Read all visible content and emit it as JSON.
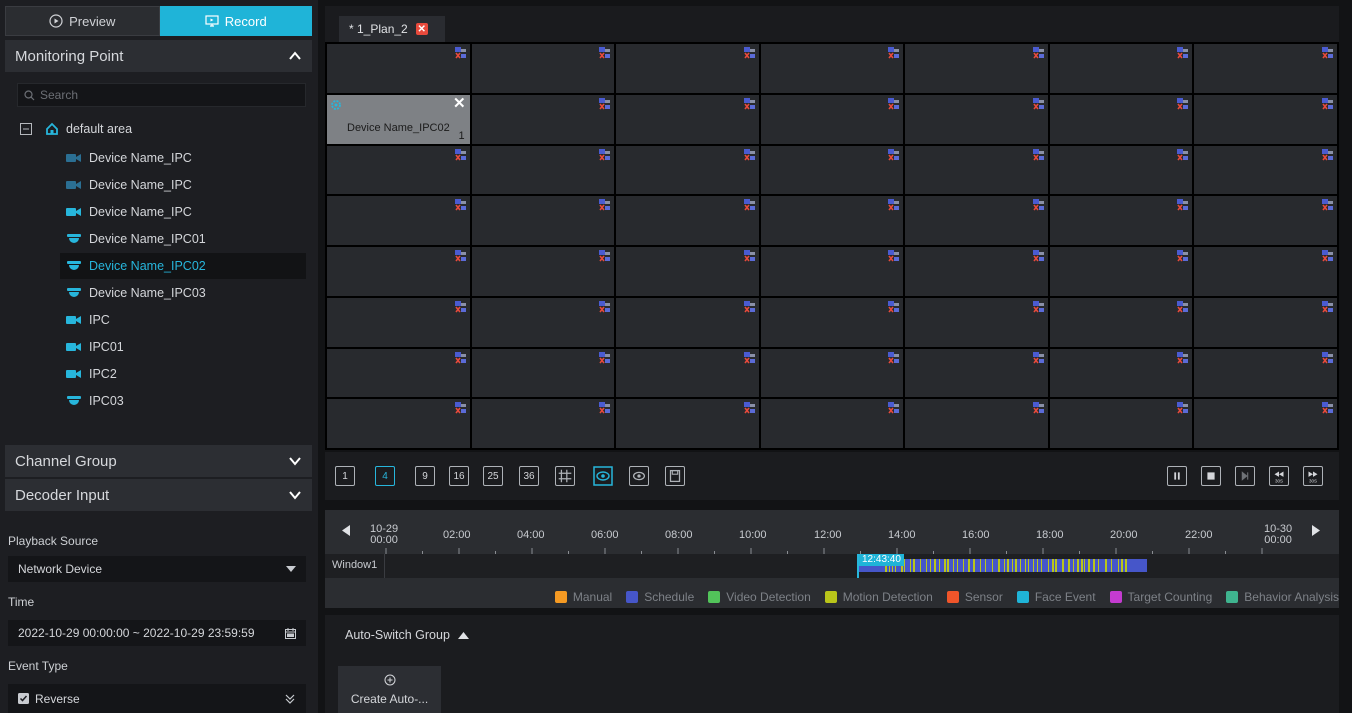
{
  "tabs": {
    "preview": "Preview",
    "record": "Record"
  },
  "monitoring": {
    "title": "Monitoring Point",
    "search_placeholder": "Search",
    "area": "default area",
    "devices": [
      {
        "name": "Device Name_IPC",
        "icon": "bullet-camera-icon-offline"
      },
      {
        "name": "Device Name_IPC",
        "icon": "bullet-camera-icon-offline"
      },
      {
        "name": "Device Name_IPC",
        "icon": "bullet-camera-icon"
      },
      {
        "name": "Device Name_IPC01",
        "icon": "dome-camera-icon"
      },
      {
        "name": "Device Name_IPC02",
        "icon": "dome-camera-icon",
        "selected": true
      },
      {
        "name": "Device Name_IPC03",
        "icon": "dome-camera-icon"
      },
      {
        "name": "IPC",
        "icon": "bullet-camera-icon"
      },
      {
        "name": "IPC01",
        "icon": "bullet-camera-icon"
      },
      {
        "name": "IPC2",
        "icon": "bullet-camera-icon"
      },
      {
        "name": "IPC03",
        "icon": "dome-camera-icon"
      }
    ]
  },
  "channel_group": "Channel Group",
  "decoder_input": "Decoder Input",
  "playback_source": {
    "label": "Playback Source",
    "value": "Network Device"
  },
  "time": {
    "label": "Time",
    "value": "2022-10-29 00:00:00 ~ 2022-10-29 23:59:59"
  },
  "event_type": {
    "label": "Event Type",
    "reverse_label": "Reverse",
    "reverse_checked": true
  },
  "plan_tab": {
    "label": "* 1_Plan_2",
    "close": "✕"
  },
  "grid": {
    "occupied": {
      "name": "Device Name_IPC02",
      "number": "1",
      "close": "✕"
    }
  },
  "split_buttons": [
    "1",
    "4",
    "9",
    "16",
    "25",
    "36"
  ],
  "timeline": {
    "start": {
      "date": "10-29",
      "time": "00:00"
    },
    "ticks": [
      "02:00",
      "04:00",
      "06:00",
      "08:00",
      "10:00",
      "12:00",
      "14:00",
      "16:00",
      "18:00",
      "20:00",
      "22:00"
    ],
    "end": {
      "date": "10-30",
      "time": "00:00"
    },
    "window_label": "Window1",
    "cursor_time": "12:43:40"
  },
  "legend": [
    {
      "label": "Manual",
      "color": "#f59a23"
    },
    {
      "label": "Schedule",
      "color": "#4656c9"
    },
    {
      "label": "Video Detection",
      "color": "#52c45a"
    },
    {
      "label": "Motion Detection",
      "color": "#b9c51a"
    },
    {
      "label": "Sensor",
      "color": "#f0552a"
    },
    {
      "label": "Face Event",
      "color": "#1fb4d8"
    },
    {
      "label": "Target Counting",
      "color": "#c43bd0"
    },
    {
      "label": "Behavior Analysis",
      "color": "#3fb48f"
    }
  ],
  "auto_switch": {
    "title": "Auto-Switch Group",
    "create_label": "Create Auto-..."
  }
}
